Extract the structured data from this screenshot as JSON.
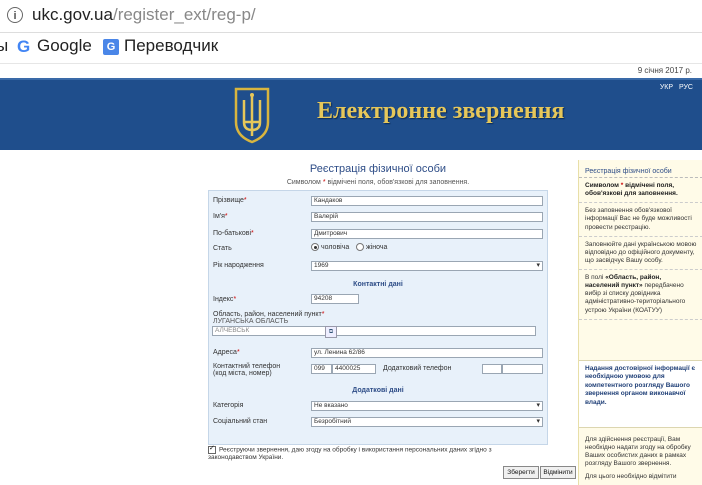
{
  "browser": {
    "url_host": "ukc.gov.ua",
    "url_path": "/register_ext/reg-p/",
    "bookmark_clip": "ы",
    "bookmarks": [
      {
        "icon": "G",
        "label": "Google"
      },
      {
        "icon": "G",
        "label": "Переводчик"
      }
    ]
  },
  "page": {
    "date": "9 січня 2017 р.",
    "lang": [
      "УКР",
      "РУС"
    ],
    "title": "Електронне звернення"
  },
  "form": {
    "title": "Реєстрація фізичної особи",
    "subtitle_prefix": "Символом",
    "subtitle_star": "*",
    "subtitle_suffix": "відмічені поля, обов'язкові для заповнення.",
    "fields": {
      "surname": {
        "label": "Прізвище",
        "value": "Кандаков"
      },
      "name": {
        "label": "Ім'я",
        "value": "Валерій"
      },
      "patronymic": {
        "label": "По-батькові",
        "value": "Дмитрович"
      },
      "sex": {
        "label": "Стать",
        "male": "чоловіча",
        "female": "жіноча"
      },
      "birth_year": {
        "label": "Рік народження",
        "value": "1969"
      },
      "index": {
        "label": "Індекс",
        "value": "94208"
      },
      "region": {
        "label": "Область, район, населений пункт",
        "value1": "ЛУГАНСЬКА ОБЛАСТЬ",
        "value2": "АЛЧЕВСЬК"
      },
      "address": {
        "label": "Адреса",
        "value": "ул. Ленина 62/86"
      },
      "phone": {
        "label1": "Контактний телефон",
        "label2": "(код міста, номер)",
        "code": "099",
        "number": "4400025"
      },
      "phone2": {
        "label": "Додатковий телефон"
      },
      "category": {
        "label": "Категорія",
        "value": "Не вказано"
      },
      "social": {
        "label": "Соціальний стан",
        "value": "Безробітний"
      }
    },
    "sections": {
      "contacts": "Контактні дані",
      "additional": "Додаткові дані"
    },
    "consent": "Реєструючи звернення, даю згоду на обробку і використання персональних даних згідно з законодавством України.",
    "buttons": {
      "submit": "Зберегти",
      "cancel": "Відмінити"
    }
  },
  "sidebar": {
    "title": "Реєстрація фізичної особи",
    "b1_prefix": "Символом",
    "b1_star": "*",
    "b1_suffix": "відмічені поля, обов'язкові для заповнення.",
    "b2": "Без заповнення обов'язкової інформації Вас не буде можливості провести реєстрацію.",
    "b3": "Заповнюйте дані українською мовою відповідно до офіційного документу, що засвідчує Вашу особу.",
    "b4_prefix": "В полі",
    "b4_bold": "«Область, район, населений пункт»",
    "b4_suffix": "передбачено вибір зі списку довідника адміністративно-територіального устрою України (КОАТУУ)",
    "info": "Надання достовірної інформації є необхідною умовою для компетентного розгляду Вашого звернення органом виконавчої влади.",
    "b5": "Для здійснення реєстрації, Вам необхідно надати згоду на обробку Ваших особистих даних в рамках розгляду Вашого звернення.",
    "b6": "Для цього необхідно відмітити"
  }
}
